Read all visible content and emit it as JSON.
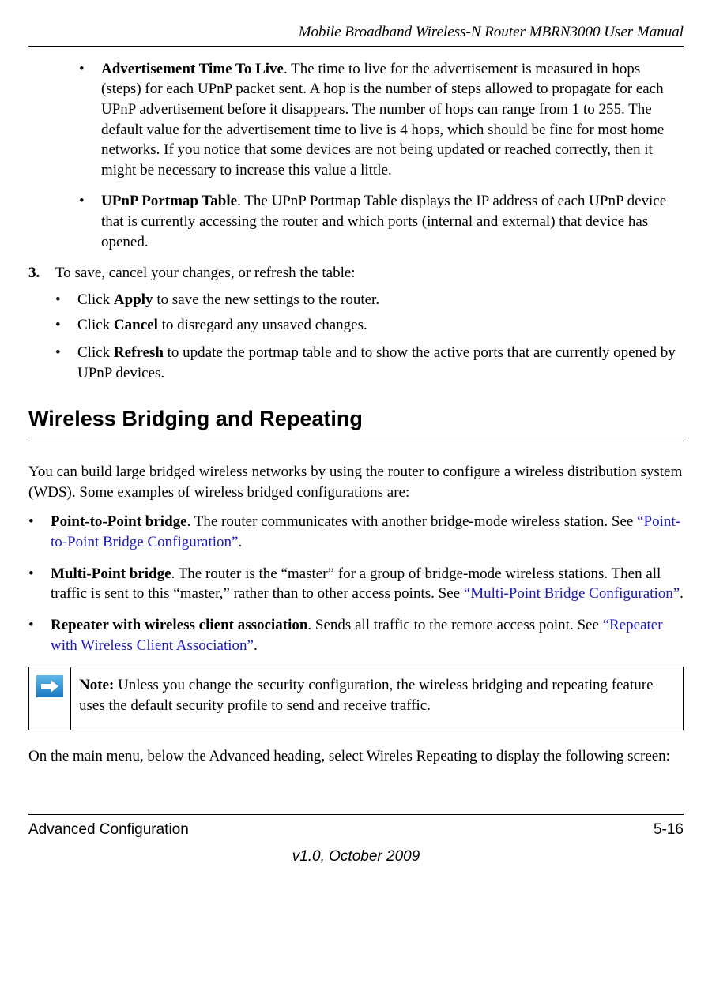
{
  "header": {
    "title": "Mobile Broadband Wireless-N Router MBRN3000 User Manual"
  },
  "content": {
    "bullet1_bold": "Advertisement Time To Live",
    "bullet1_text": ". The time to live for the advertisement is measured in hops (steps) for each UPnP packet sent. A hop is the number of steps allowed to propagate for each UPnP advertisement before it disappears. The number of hops can range from 1 to 255. The default value for the advertisement time to live is 4 hops, which should be fine for most home networks. If you notice that some devices are not being updated or reached correctly, then it might be necessary to increase this value a little.",
    "bullet2_bold": "UPnP Portmap Table",
    "bullet2_text": ". The UPnP Portmap Table displays the IP address of each UPnP device that is currently accessing the router and which ports (internal and external) that device has opened.",
    "step3_num": "3.",
    "step3_text": "To save, cancel your changes, or refresh the table:",
    "step3_sub1_pre": "Click ",
    "step3_sub1_bold": "Apply",
    "step3_sub1_post": " to save the new settings to the router.",
    "step3_sub2_pre": "Click ",
    "step3_sub2_bold": "Cancel",
    "step3_sub2_post": " to disregard any unsaved changes.",
    "step3_sub3_pre": "Click ",
    "step3_sub3_bold": "Refresh",
    "step3_sub3_post": " to update the portmap table and to show the active ports that are currently opened by UPnP devices.",
    "section_heading": "Wireless Bridging and Repeating",
    "intro_para": "You can build large bridged wireless networks by using the router to configure a wireless distribution system (WDS). Some examples of wireless bridged configurations are:",
    "b1_bold": "Point-to-Point bridge",
    "b1_text": ". The router communicates with another bridge-mode wireless station. See ",
    "b1_link": "“Point-to-Point Bridge Configuration”",
    "b1_post": ".",
    "b2_bold": "Multi-Point bridge",
    "b2_text": ". The router is the “master” for a group of bridge-mode wireless stations. Then all traffic is sent to this “master,” rather than to other access points. See ",
    "b2_link": "“Multi-Point Bridge Configuration”",
    "b2_post": ".",
    "b3_bold": "Repeater with wireless client association",
    "b3_text": ". Sends all traffic to the remote access point. See ",
    "b3_link": "“Repeater with Wireless Client Association”",
    "b3_post": ".",
    "note_bold": "Note:",
    "note_text": " Unless you change the security configuration, the wireless bridging and repeating feature uses the default security profile to send and receive traffic.",
    "closing_para": "On the main menu, below the Advanced heading, select Wireles Repeating to display the following screen:"
  },
  "footer": {
    "left": "Advanced Configuration",
    "right": "5-16",
    "version": "v1.0, October 2009"
  }
}
